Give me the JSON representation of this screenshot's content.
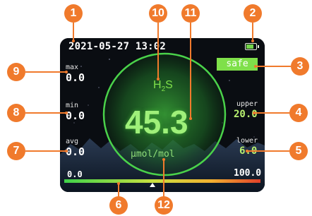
{
  "device": {
    "datetime": "2021-05-27 13:02",
    "battery_level": 0.8,
    "status": "safe",
    "gas": {
      "symbol": "H",
      "subscript": "2",
      "suffix": "S"
    },
    "reading": "45.3",
    "unit": "μmol/mol",
    "stats": {
      "max": {
        "label": "max",
        "value": "0.0"
      },
      "min": {
        "label": "min",
        "value": "0.0"
      },
      "avg": {
        "label": "avg",
        "value": "0.0"
      }
    },
    "thresholds": {
      "upper": {
        "label": "upper",
        "value": "20.0"
      },
      "lower": {
        "label": "lower",
        "value": "6.0"
      }
    },
    "scale": {
      "min": "0.0",
      "max": "100.0",
      "pointer_fraction": 0.45
    }
  },
  "colors": {
    "accent_green": "#7fe04a",
    "callout_orange": "#f07a2c",
    "screen_background": "#0a0d12"
  },
  "callouts": [
    "1",
    "2",
    "3",
    "4",
    "5",
    "6",
    "7",
    "8",
    "9",
    "10",
    "11",
    "12"
  ]
}
